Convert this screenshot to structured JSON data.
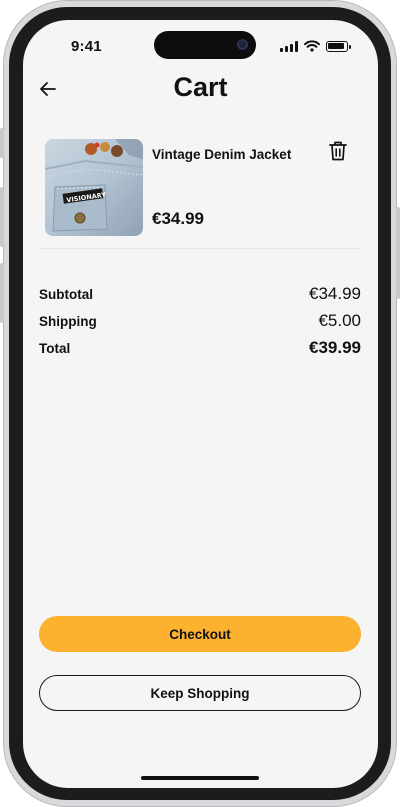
{
  "status_bar": {
    "time": "9:41"
  },
  "header": {
    "title": "Cart"
  },
  "cart": {
    "items": [
      {
        "name": "Vintage Denim Jacket",
        "price": "€34.99",
        "image_badge": "VISIONARY"
      }
    ]
  },
  "summary": {
    "subtotal_label": "Subtotal",
    "subtotal_value": "€34.99",
    "shipping_label": "Shipping",
    "shipping_value": "€5.00",
    "total_label": "Total",
    "total_value": "€39.99"
  },
  "actions": {
    "checkout_label": "Checkout",
    "keep_shopping_label": "Keep Shopping"
  },
  "colors": {
    "accent": "#fdb22f",
    "background": "#f5f5f5",
    "text": "#111111"
  },
  "icons": [
    "back-arrow-icon",
    "trash-icon",
    "signal-icon",
    "wifi-icon",
    "battery-icon"
  ]
}
